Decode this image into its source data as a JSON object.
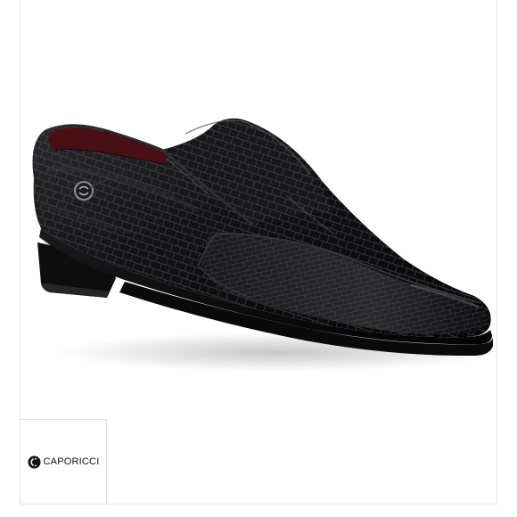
{
  "logo": {
    "brand_text": "CAPORICCI",
    "mark_icon": "caporicci-c-logo-icon"
  },
  "product": {
    "image_icon": "black-crocodile-loafer-shoe",
    "leather_color": "#0b0b0c",
    "lining_color": "#4a0f14",
    "background_color": "#ffffff"
  }
}
